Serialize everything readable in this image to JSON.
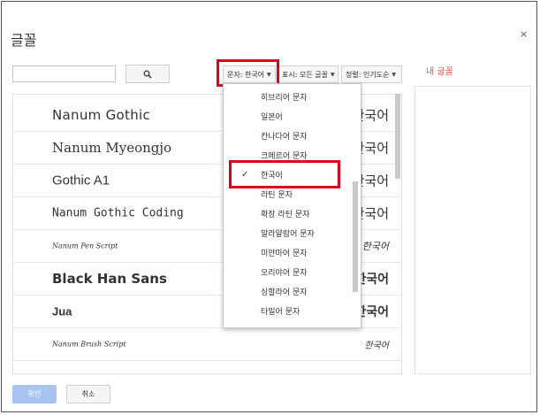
{
  "dialog": {
    "title": "글꼴",
    "close_label": "×"
  },
  "toolbar": {
    "search_value": "",
    "search_icon": "search-icon",
    "script_filter": "문자: 한국어",
    "show_filter": "표시: 모든 글꼴",
    "sort_filter": "정렬: 인기도순"
  },
  "my_fonts": {
    "title": "내 글꼴"
  },
  "fonts": [
    {
      "name": "Nanum Gothic",
      "sample": "한국어"
    },
    {
      "name": "Nanum Myeongjo",
      "sample": "한국어"
    },
    {
      "name": "Gothic A1",
      "sample": "한국어"
    },
    {
      "name": "Nanum Gothic Coding",
      "sample": "한국어"
    },
    {
      "name": "Nanum Pen Script",
      "sample": "한국어"
    },
    {
      "name": "Black Han Sans",
      "sample": "한국어"
    },
    {
      "name": "Jua",
      "sample": "한국어"
    },
    {
      "name": "Nanum Brush Script",
      "sample": "한국어"
    }
  ],
  "script_menu": {
    "items": [
      {
        "label": "히브리어 문자"
      },
      {
        "label": "일본어"
      },
      {
        "label": "칸나다어 문자"
      },
      {
        "label": "크메르어 문자"
      },
      {
        "label": "한국어",
        "selected": true
      },
      {
        "label": "라틴 문자"
      },
      {
        "label": "확장 라틴 문자"
      },
      {
        "label": "말라얄람어 문자"
      },
      {
        "label": "미얀마어 문자"
      },
      {
        "label": "오리야어 문자"
      },
      {
        "label": "싱할라어 문자"
      },
      {
        "label": "타밀어 문자"
      }
    ],
    "check_mark": "✓"
  },
  "footer": {
    "ok_label": "확인",
    "cancel_label": "취소"
  },
  "colors": {
    "highlight": "#e0001b",
    "accent_red": "#dd4b39",
    "ok_button": "#a7c3f0"
  }
}
